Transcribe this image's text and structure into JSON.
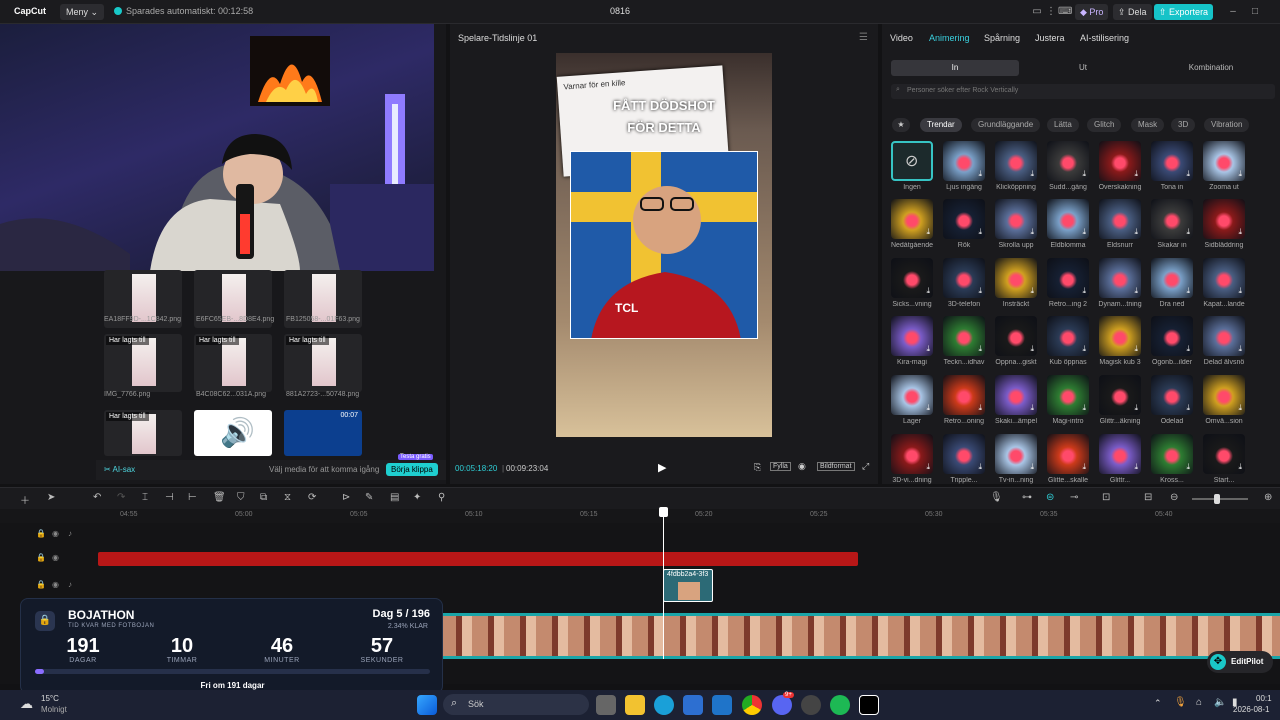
{
  "titlebar": {
    "logo": "CapCut",
    "menu": "Meny ⌄",
    "autosave": "Sparades automatiskt: 00:12:58",
    "project": "0816",
    "pro": "Pro",
    "share": "Dela",
    "export": "Exportera"
  },
  "media": {
    "files": [
      {
        "name": "EA18FF9D-...1C842.png",
        "tag": ""
      },
      {
        "name": "E6FC65EB-...8D8E4.png",
        "tag": ""
      },
      {
        "name": "FB125058-...01F63.png",
        "tag": ""
      },
      {
        "name": "IMG_7766.png",
        "tag": "Har lagts till"
      },
      {
        "name": "B4C08C62...031A.png",
        "tag": "Har lagts till"
      },
      {
        "name": "881A2723-...50748.png",
        "tag": "Har lagts till"
      },
      {
        "name": "",
        "tag": "Har lagts till"
      },
      {
        "name": "",
        "tag": "Har lagts till"
      },
      {
        "name": "",
        "tag": ""
      }
    ],
    "audio_duration": "00:07",
    "ai_label": "AI-sax",
    "hint": "Välj media för att komma igång",
    "start_btn": "Börja klippa",
    "trial_badge": "Testa gratis"
  },
  "player": {
    "title": "Spelare-Tidslinje 01",
    "caption_card": "Varnar för en kille",
    "headline_1": "FÅTT DÖDSHOT",
    "headline_2": "FÖR DETTA",
    "current_time": "00:05:18:20",
    "total_time": "00:09:23:04",
    "full_label": "Fylla",
    "ratio_label": "Bildformat"
  },
  "props": {
    "tabs": [
      "Video",
      "Animering",
      "Spårning",
      "Justera",
      "AI-stilisering"
    ],
    "active_tab": "Animering",
    "subtabs": [
      "In",
      "Ut",
      "Kombination"
    ],
    "search_placeholder": "Personer söker efter Rock Vertically",
    "chips": [
      "Trendar",
      "Grundläggande",
      "Lätta",
      "Glitch",
      "Mask",
      "3D",
      "Vibration"
    ],
    "effects": [
      "Ingen",
      "Ljus ingång",
      "Klicköppning",
      "Sudd...gång",
      "Överskakning",
      "Tona in",
      "Zooma ut",
      "Nedåtgående",
      "Rök",
      "Skrolla upp",
      "Eldblomma",
      "Eldsnurr",
      "Skakar in",
      "Sidbläddring",
      "Sicks...vning",
      "3D-telefon",
      "Insträckt",
      "Retro...ing 2",
      "Dynam...tning",
      "Dra ned",
      "Kapat...lande",
      "Kira-magi",
      "Teckn...idhav",
      "Öppna...giskt",
      "Kub öppnas",
      "Magisk kub 3",
      "Ögonb...ilder",
      "Delad älvsnö",
      "Lager",
      "Retro...oning",
      "Skaki...ämpel",
      "Magi-intro",
      "Glittr...äkning",
      "Odelad",
      "Omvä...sion",
      "3D-vi...dning",
      "Tripple...",
      "Tv-in...ning",
      "Glitte...skalle",
      "Glittr...",
      "Kross...",
      "Start..."
    ]
  },
  "timeline": {
    "ruler": [
      "04:55",
      "05:00",
      "05:05",
      "05:10",
      "05:15",
      "05:20",
      "05:25",
      "05:30",
      "05:35",
      "05:40"
    ],
    "clip_label": "4fdbb2a4-3f3",
    "editpilot": "EditPilot"
  },
  "overlay": {
    "title": "BOJATHON",
    "subtitle": "TID KVAR MED FOTBOJAN",
    "day": "Dag 5 / 196",
    "percent": "2.34% KLAR",
    "days": "191",
    "days_label": "DAGAR",
    "hours": "10",
    "hours_label": "TIMMAR",
    "minutes": "46",
    "minutes_label": "MINUTER",
    "seconds": "57",
    "seconds_label": "SEKUNDER",
    "footer": "Fri om 191 dagar",
    "progress": 0.0234
  },
  "taskbar": {
    "temp": "15°C",
    "weather": "Molnigt",
    "search": "Sök",
    "time": "00:1",
    "date": "2026-08-1",
    "badge": "9+"
  }
}
